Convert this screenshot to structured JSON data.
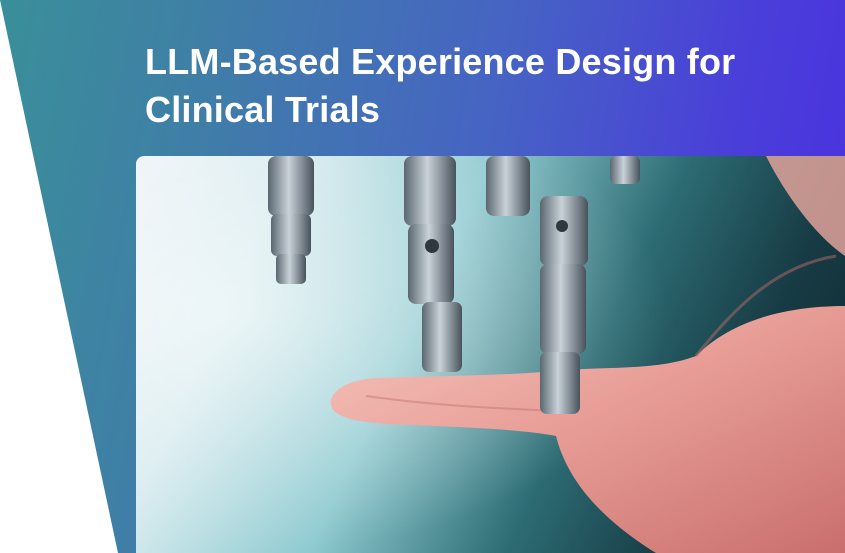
{
  "header": {
    "title_line1": "LLM-Based Experience Design for",
    "title_line2": "Clinical Trials"
  },
  "hero": {
    "image_icon": "robot-hand-touching-human-hand"
  },
  "colors": {
    "gradient_start": "#3a8f99",
    "gradient_end": "#4b2ee0",
    "title_text": "#ffffff"
  }
}
